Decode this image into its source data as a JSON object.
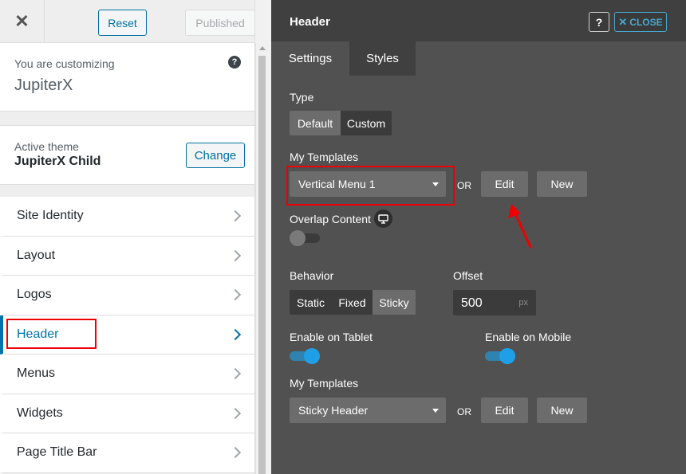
{
  "sidebar": {
    "topbar": {
      "close_icon": "close-icon",
      "reset_label": "Reset",
      "published_label": "Published"
    },
    "customizing": {
      "label": "You are customizing",
      "theme": "JupiterX",
      "help_icon": "?"
    },
    "active_theme": {
      "label": "Active theme",
      "name": "JupiterX Child",
      "change_label": "Change"
    },
    "items": [
      {
        "label": "Site Identity"
      },
      {
        "label": "Layout"
      },
      {
        "label": "Logos"
      },
      {
        "label": "Header",
        "active": true
      },
      {
        "label": "Menus"
      },
      {
        "label": "Widgets"
      },
      {
        "label": "Page Title Bar"
      }
    ]
  },
  "panel": {
    "title": "Header",
    "help_label": "?",
    "close_label": "CLOSE",
    "close_icon": "close-icon",
    "tabs": [
      {
        "label": "Settings",
        "active": true
      },
      {
        "label": "Styles",
        "active": false
      }
    ],
    "type": {
      "label": "Type",
      "options": [
        "Default",
        "Custom"
      ],
      "selected": "Default"
    },
    "my_templates_1": {
      "label": "My Templates",
      "selected": "Vertical Menu 1",
      "or": "OR",
      "edit_label": "Edit",
      "new_label": "New"
    },
    "overlap": {
      "label": "Overlap Content",
      "icon": "monitor-icon",
      "enabled": false
    },
    "behavior": {
      "label": "Behavior",
      "options": [
        "Static",
        "Fixed",
        "Sticky"
      ],
      "selected": "Sticky"
    },
    "offset": {
      "label": "Offset",
      "value": "500",
      "unit": "px"
    },
    "tablet": {
      "label": "Enable on Tablet",
      "enabled": true
    },
    "mobile": {
      "label": "Enable on Mobile",
      "enabled": true
    },
    "my_templates_2": {
      "label": "My Templates",
      "selected": "Sticky Header",
      "or": "OR",
      "edit_label": "Edit",
      "new_label": "New"
    }
  },
  "colors": {
    "accent_blue": "#0073aa",
    "toggle_on": "#1fa0e6",
    "highlight_red": "#ee0000"
  }
}
